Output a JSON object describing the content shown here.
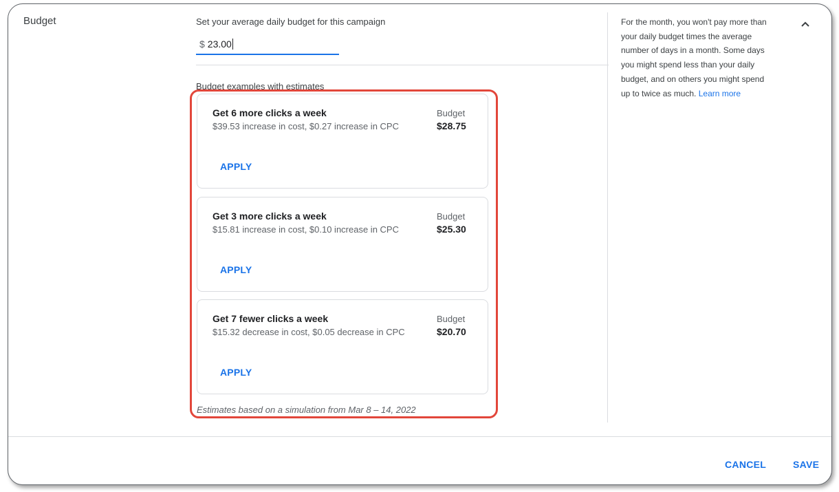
{
  "section": {
    "label": "Budget"
  },
  "budget_field": {
    "label": "Set your average daily budget for this campaign",
    "currency": "$",
    "value": "23.00"
  },
  "examples": {
    "heading": "Budget examples with estimates",
    "cards": [
      {
        "title": "Get 6 more clicks a week",
        "description": "$39.53 increase in cost, $0.27 increase in CPC",
        "budget_caption": "Budget",
        "budget_amount": "$28.75",
        "apply_label": "APPLY"
      },
      {
        "title": "Get 3 more clicks a week",
        "description": "$15.81 increase in cost, $0.10 increase in CPC",
        "budget_caption": "Budget",
        "budget_amount": "$25.30",
        "apply_label": "APPLY"
      },
      {
        "title": "Get 7 fewer clicks a week",
        "description": "$15.32 decrease in cost, $0.05 decrease in CPC",
        "budget_caption": "Budget",
        "budget_amount": "$20.70",
        "apply_label": "APPLY"
      }
    ],
    "note": "Estimates based on a simulation from Mar 8 – 14, 2022"
  },
  "help": {
    "text": "For the month, you won't pay more than your daily budget times the average number of days in a month. Some days you might spend less than your daily budget, and on others you might spend up to twice as much.",
    "link_label": "Learn more"
  },
  "collapse_icon": "chevron-up-icon",
  "footer": {
    "cancel_label": "CANCEL",
    "save_label": "SAVE"
  },
  "colors": {
    "accent": "#1a73e8",
    "highlight": "#e2463a",
    "divider": "#dadce0"
  }
}
